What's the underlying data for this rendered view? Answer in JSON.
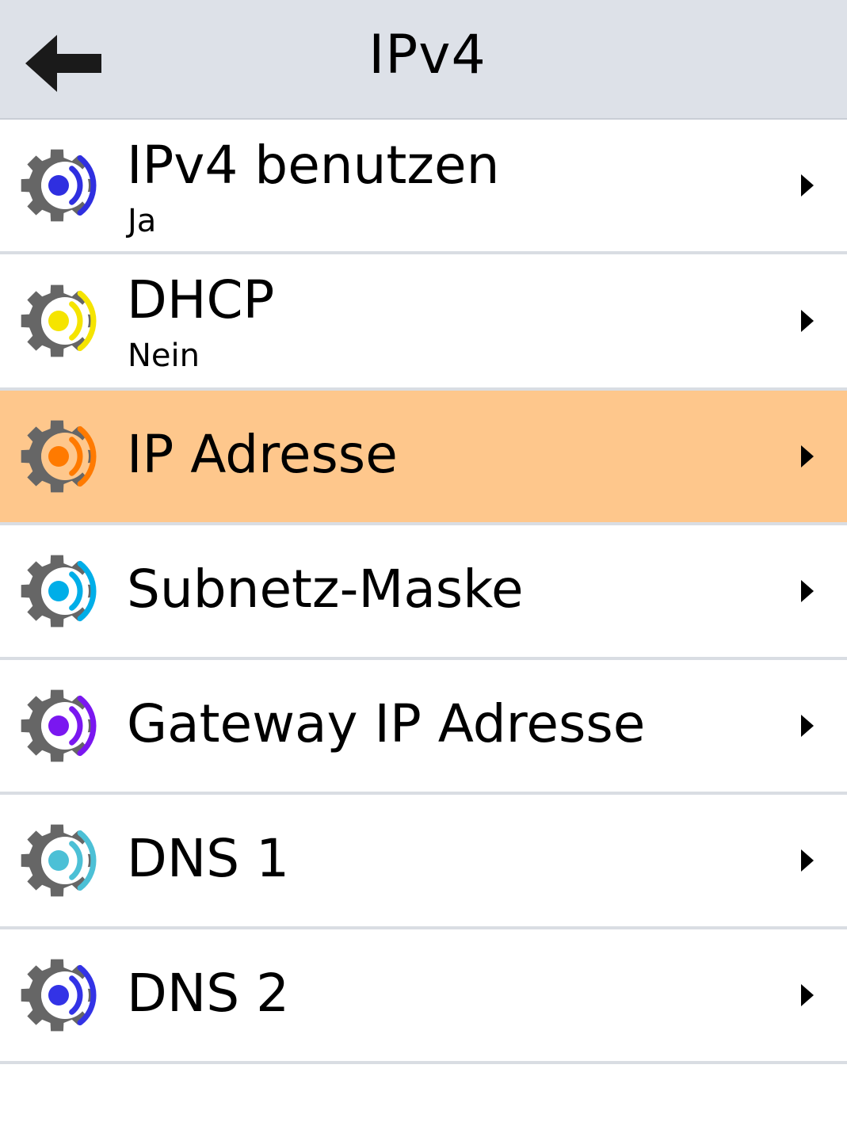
{
  "header": {
    "title": "IPv4",
    "back_icon": "arrow-left-icon"
  },
  "items": [
    {
      "label": "IPv4 benutzen",
      "value": "Ja",
      "accent": "#2f2fe0",
      "icon": "gear-signal-icon"
    },
    {
      "label": "DHCP",
      "value": "Nein",
      "accent": "#f5e400",
      "icon": "gear-signal-icon"
    },
    {
      "label": "IP Adresse",
      "accent": "#ff7a00",
      "icon": "gear-signal-icon",
      "selected": true
    },
    {
      "label": "Subnetz-Maske",
      "accent": "#00aee8",
      "icon": "gear-signal-icon"
    },
    {
      "label": "Gateway IP Adresse",
      "accent": "#7a17f0",
      "icon": "gear-signal-icon"
    },
    {
      "label": "DNS 1",
      "accent": "#4cc0d6",
      "icon": "gear-signal-icon"
    },
    {
      "label": "DNS 2",
      "accent": "#3333e6",
      "icon": "gear-signal-icon"
    }
  ],
  "colors": {
    "header_bg": "#dde1e8",
    "selected_bg": "#fec78c",
    "divider": "#d9dde3",
    "gear": "#666666"
  }
}
